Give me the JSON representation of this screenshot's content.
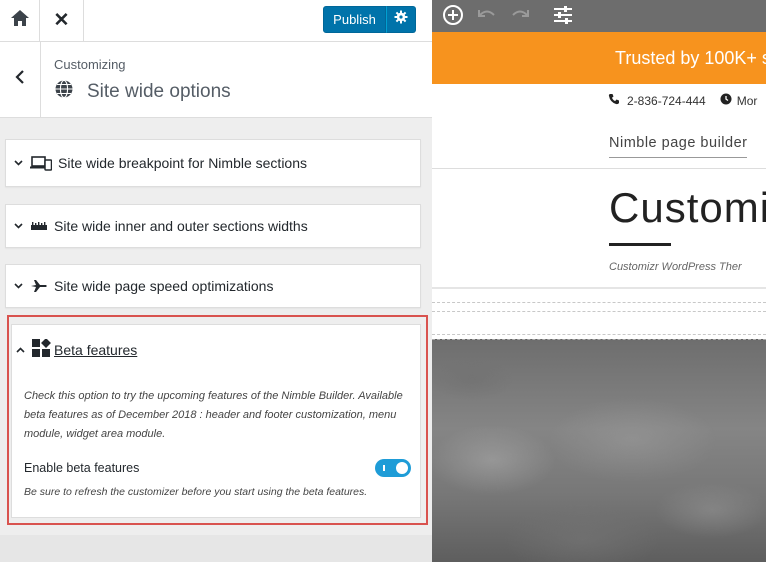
{
  "topbar": {
    "home_icon": "home-icon",
    "close_icon": "close-icon",
    "close_glyph": "✕",
    "publish_label": "Publish",
    "publish_settings_icon": "gear-icon",
    "accent": "#0073aa"
  },
  "header": {
    "breadcrumb": "Customizing",
    "title": "Site wide options",
    "title_icon": "globe-icon",
    "back_icon": "chevron-left-icon"
  },
  "sections": [
    {
      "label": "Site wide breakpoint for Nimble sections",
      "icon": "devices-icon"
    },
    {
      "label": "Site wide inner and outer sections widths",
      "icon": "ruler-icon"
    },
    {
      "label": "Site wide page speed optimizations",
      "icon": "airplane-icon"
    }
  ],
  "beta": {
    "title": "Beta features",
    "icon": "blocks-icon",
    "description": "Check this option to try the upcoming features of the Nimble Builder. Available beta features as of December 2018 : header and footer customization, menu module, widget area module.",
    "toggle_label": "Enable beta features",
    "toggle_on": true,
    "note": "Be sure to refresh the customizer before you start using the beta features.",
    "highlight_color": "#d9534f"
  },
  "preview": {
    "toolbar_icons": [
      "add-section-icon",
      "undo-icon",
      "redo-icon",
      "settings-sliders-icon"
    ],
    "banner_text": "Trusted by 100K+ s",
    "banner_color": "#f7931e",
    "phone": "2-836-724-444",
    "hours_fragment": "Mor",
    "nav_link": "Nimble page builder",
    "hero_title": "Customi",
    "tagline": "Customizr WordPress Ther"
  }
}
